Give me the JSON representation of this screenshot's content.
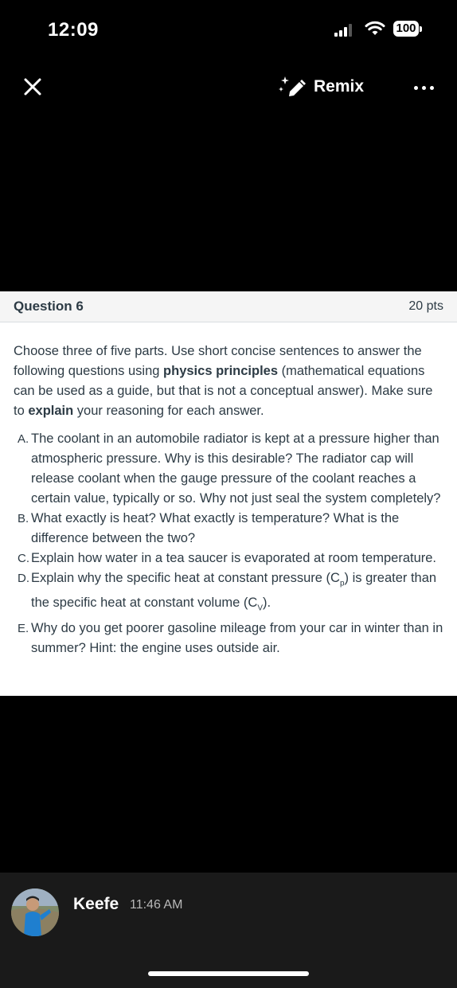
{
  "status_bar": {
    "time": "12:09",
    "battery": "100"
  },
  "nav": {
    "remix_label": "Remix"
  },
  "question": {
    "title": "Question 6",
    "points": "20 pts",
    "intro_1": "Choose three of five parts. Use short concise sentences to answer the following questions using ",
    "intro_bold_1": "physics principles",
    "intro_2": " (mathematical equations can be used as a guide, but that is not a conceptual answer). Make sure to ",
    "intro_bold_2": "explain",
    "intro_3": " your reasoning for each answer.",
    "parts": [
      {
        "marker": "A.",
        "text": "The coolant in an automobile radiator is kept at a pressure higher than atmospheric pressure. Why is this desirable? The radiator cap will release coolant when the gauge pressure of the coolant reaches a certain value, typically or so. Why not just seal the system completely?"
      },
      {
        "marker": "B.",
        "text": "What exactly is heat? What exactly is temperature? What is the difference between the two?"
      },
      {
        "marker": "C.",
        "text": "Explain how water in a tea saucer is evaporated at room temperature."
      },
      {
        "marker": "D.",
        "text_1": "Explain why the specific heat at constant pressure (C",
        "sub_1": "p",
        "text_2": ") is greater than the specific heat at constant volume (C",
        "sub_2": "V",
        "text_3": ")."
      },
      {
        "marker": "E.",
        "text": "Why do you get poorer gasoline mileage from your car in winter than in summer? Hint: the engine uses outside air."
      }
    ]
  },
  "post": {
    "user_name": "Keefe",
    "time": "11:46 AM"
  },
  "colors": {
    "background": "#000000",
    "card": "#ffffff",
    "text": "#2d3b45",
    "header_bg": "#f5f5f5"
  },
  "icons": {
    "close": "close-icon",
    "remix": "sparkle-pencil-icon",
    "more": "more-dots-icon"
  }
}
